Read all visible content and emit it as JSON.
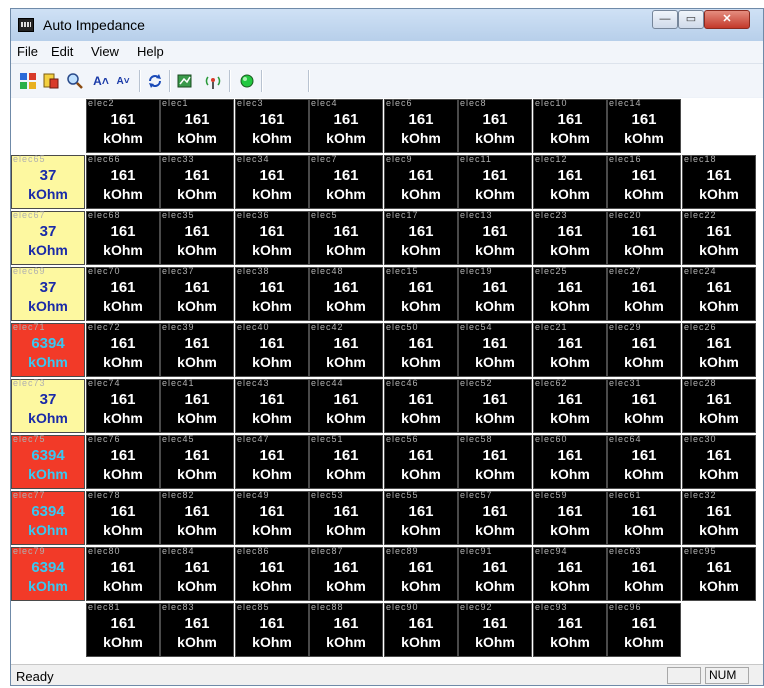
{
  "window": {
    "title": "Auto Impedance",
    "controls": {
      "minimize": "—",
      "maximize": "▭",
      "close": "✕"
    }
  },
  "menu": [
    "File",
    "Edit",
    "View",
    "Help"
  ],
  "toolbar": {
    "font_larger_label": "A˄",
    "font_smaller_label": "A˅"
  },
  "grid": {
    "rows": [
      [
        null,
        {
          "label": "elec2",
          "value": "161",
          "unit": "kOhm"
        },
        {
          "label": "elec1",
          "value": "161",
          "unit": "kOhm"
        },
        {
          "label": "elec3",
          "value": "161",
          "unit": "kOhm"
        },
        {
          "label": "elec4",
          "value": "161",
          "unit": "kOhm"
        },
        {
          "label": "elec6",
          "value": "161",
          "unit": "kOhm"
        },
        {
          "label": "elec8",
          "value": "161",
          "unit": "kOhm"
        },
        {
          "label": "elec10",
          "value": "161",
          "unit": "kOhm"
        },
        {
          "label": "elec14",
          "value": "161",
          "unit": "kOhm"
        },
        null
      ],
      [
        {
          "label": "elec65",
          "value": "37",
          "unit": "kOhm",
          "status": "yellow"
        },
        {
          "label": "elec66",
          "value": "161",
          "unit": "kOhm"
        },
        {
          "label": "elec33",
          "value": "161",
          "unit": "kOhm"
        },
        {
          "label": "elec34",
          "value": "161",
          "unit": "kOhm"
        },
        {
          "label": "elec7",
          "value": "161",
          "unit": "kOhm"
        },
        {
          "label": "elec9",
          "value": "161",
          "unit": "kOhm"
        },
        {
          "label": "elec11",
          "value": "161",
          "unit": "kOhm"
        },
        {
          "label": "elec12",
          "value": "161",
          "unit": "kOhm"
        },
        {
          "label": "elec16",
          "value": "161",
          "unit": "kOhm"
        },
        {
          "label": "elec18",
          "value": "161",
          "unit": "kOhm"
        }
      ],
      [
        {
          "label": "elec67",
          "value": "37",
          "unit": "kOhm",
          "status": "yellow"
        },
        {
          "label": "elec68",
          "value": "161",
          "unit": "kOhm"
        },
        {
          "label": "elec35",
          "value": "161",
          "unit": "kOhm"
        },
        {
          "label": "elec36",
          "value": "161",
          "unit": "kOhm"
        },
        {
          "label": "elec5",
          "value": "161",
          "unit": "kOhm"
        },
        {
          "label": "elec17",
          "value": "161",
          "unit": "kOhm"
        },
        {
          "label": "elec13",
          "value": "161",
          "unit": "kOhm"
        },
        {
          "label": "elec23",
          "value": "161",
          "unit": "kOhm"
        },
        {
          "label": "elec20",
          "value": "161",
          "unit": "kOhm"
        },
        {
          "label": "elec22",
          "value": "161",
          "unit": "kOhm"
        }
      ],
      [
        {
          "label": "elec69",
          "value": "37",
          "unit": "kOhm",
          "status": "yellow"
        },
        {
          "label": "elec70",
          "value": "161",
          "unit": "kOhm"
        },
        {
          "label": "elec37",
          "value": "161",
          "unit": "kOhm"
        },
        {
          "label": "elec38",
          "value": "161",
          "unit": "kOhm"
        },
        {
          "label": "elec48",
          "value": "161",
          "unit": "kOhm"
        },
        {
          "label": "elec15",
          "value": "161",
          "unit": "kOhm"
        },
        {
          "label": "elec19",
          "value": "161",
          "unit": "kOhm"
        },
        {
          "label": "elec25",
          "value": "161",
          "unit": "kOhm"
        },
        {
          "label": "elec27",
          "value": "161",
          "unit": "kOhm"
        },
        {
          "label": "elec24",
          "value": "161",
          "unit": "kOhm"
        }
      ],
      [
        {
          "label": "elec71",
          "value": "6394",
          "unit": "kOhm",
          "status": "red"
        },
        {
          "label": "elec72",
          "value": "161",
          "unit": "kOhm"
        },
        {
          "label": "elec39",
          "value": "161",
          "unit": "kOhm"
        },
        {
          "label": "elec40",
          "value": "161",
          "unit": "kOhm"
        },
        {
          "label": "elec42",
          "value": "161",
          "unit": "kOhm"
        },
        {
          "label": "elec50",
          "value": "161",
          "unit": "kOhm"
        },
        {
          "label": "elec54",
          "value": "161",
          "unit": "kOhm"
        },
        {
          "label": "elec21",
          "value": "161",
          "unit": "kOhm"
        },
        {
          "label": "elec29",
          "value": "161",
          "unit": "kOhm"
        },
        {
          "label": "elec26",
          "value": "161",
          "unit": "kOhm"
        }
      ],
      [
        {
          "label": "elec73",
          "value": "37",
          "unit": "kOhm",
          "status": "yellow"
        },
        {
          "label": "elec74",
          "value": "161",
          "unit": "kOhm"
        },
        {
          "label": "elec41",
          "value": "161",
          "unit": "kOhm"
        },
        {
          "label": "elec43",
          "value": "161",
          "unit": "kOhm"
        },
        {
          "label": "elec44",
          "value": "161",
          "unit": "kOhm"
        },
        {
          "label": "elec46",
          "value": "161",
          "unit": "kOhm"
        },
        {
          "label": "elec52",
          "value": "161",
          "unit": "kOhm"
        },
        {
          "label": "elec62",
          "value": "161",
          "unit": "kOhm"
        },
        {
          "label": "elec31",
          "value": "161",
          "unit": "kOhm"
        },
        {
          "label": "elec28",
          "value": "161",
          "unit": "kOhm"
        }
      ],
      [
        {
          "label": "elec75",
          "value": "6394",
          "unit": "kOhm",
          "status": "red"
        },
        {
          "label": "elec76",
          "value": "161",
          "unit": "kOhm"
        },
        {
          "label": "elec45",
          "value": "161",
          "unit": "kOhm"
        },
        {
          "label": "elec47",
          "value": "161",
          "unit": "kOhm"
        },
        {
          "label": "elec51",
          "value": "161",
          "unit": "kOhm"
        },
        {
          "label": "elec56",
          "value": "161",
          "unit": "kOhm"
        },
        {
          "label": "elec58",
          "value": "161",
          "unit": "kOhm"
        },
        {
          "label": "elec60",
          "value": "161",
          "unit": "kOhm"
        },
        {
          "label": "elec64",
          "value": "161",
          "unit": "kOhm"
        },
        {
          "label": "elec30",
          "value": "161",
          "unit": "kOhm"
        }
      ],
      [
        {
          "label": "elec77",
          "value": "6394",
          "unit": "kOhm",
          "status": "red"
        },
        {
          "label": "elec78",
          "value": "161",
          "unit": "kOhm"
        },
        {
          "label": "elec82",
          "value": "161",
          "unit": "kOhm"
        },
        {
          "label": "elec49",
          "value": "161",
          "unit": "kOhm"
        },
        {
          "label": "elec53",
          "value": "161",
          "unit": "kOhm"
        },
        {
          "label": "elec55",
          "value": "161",
          "unit": "kOhm"
        },
        {
          "label": "elec57",
          "value": "161",
          "unit": "kOhm"
        },
        {
          "label": "elec59",
          "value": "161",
          "unit": "kOhm"
        },
        {
          "label": "elec61",
          "value": "161",
          "unit": "kOhm"
        },
        {
          "label": "elec32",
          "value": "161",
          "unit": "kOhm"
        }
      ],
      [
        {
          "label": "elec79",
          "value": "6394",
          "unit": "kOhm",
          "status": "red"
        },
        {
          "label": "elec80",
          "value": "161",
          "unit": "kOhm"
        },
        {
          "label": "elec84",
          "value": "161",
          "unit": "kOhm"
        },
        {
          "label": "elec86",
          "value": "161",
          "unit": "kOhm"
        },
        {
          "label": "elec87",
          "value": "161",
          "unit": "kOhm"
        },
        {
          "label": "elec89",
          "value": "161",
          "unit": "kOhm"
        },
        {
          "label": "elec91",
          "value": "161",
          "unit": "kOhm"
        },
        {
          "label": "elec94",
          "value": "161",
          "unit": "kOhm"
        },
        {
          "label": "elec63",
          "value": "161",
          "unit": "kOhm"
        },
        {
          "label": "elec95",
          "value": "161",
          "unit": "kOhm"
        }
      ],
      [
        null,
        {
          "label": "elec81",
          "value": "161",
          "unit": "kOhm"
        },
        {
          "label": "elec83",
          "value": "161",
          "unit": "kOhm"
        },
        {
          "label": "elec85",
          "value": "161",
          "unit": "kOhm"
        },
        {
          "label": "elec88",
          "value": "161",
          "unit": "kOhm"
        },
        {
          "label": "elec90",
          "value": "161",
          "unit": "kOhm"
        },
        {
          "label": "elec92",
          "value": "161",
          "unit": "kOhm"
        },
        {
          "label": "elec93",
          "value": "161",
          "unit": "kOhm"
        },
        {
          "label": "elec96",
          "value": "161",
          "unit": "kOhm"
        },
        null
      ]
    ]
  },
  "status_bar": {
    "text": "Ready",
    "indicator": "NUM"
  }
}
